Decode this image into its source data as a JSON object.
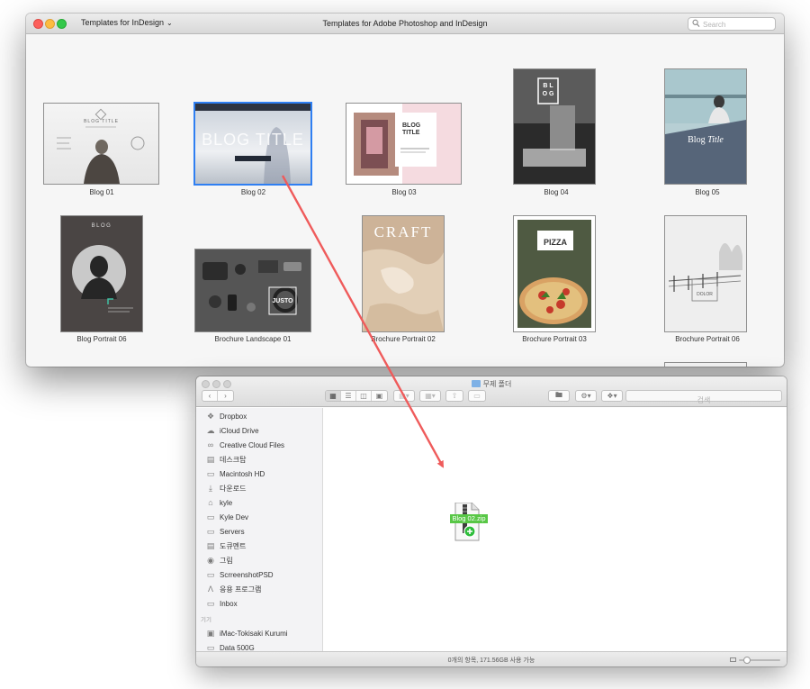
{
  "app": {
    "menu_dropdown": "Templates for InDesign",
    "title": "Templates for Adobe Photoshop and InDesign",
    "search_placeholder": "Search"
  },
  "templates": [
    {
      "label": "Blog 01"
    },
    {
      "label": "Blog 02",
      "selected": true
    },
    {
      "label": "Blog 03"
    },
    {
      "label": "Blog 04"
    },
    {
      "label": "Blog 05"
    },
    {
      "label": "Blog Portrait 06"
    },
    {
      "label": "Brochure Landscape 01"
    },
    {
      "label": "Brochure Portrait 02"
    },
    {
      "label": "Brochure Portrait 03"
    },
    {
      "label": "Brochure Portrait 06"
    }
  ],
  "thumb_text": {
    "blog01": "BLOG TITLE",
    "blog02": "BLOG TITLE",
    "blog03_a": "BLOG",
    "blog03_b": "TITLE",
    "blog04": "B L O G",
    "blog05_a": "Blog",
    "blog05_b": "Title",
    "portrait06": "BLOG",
    "justo": "JUSTO",
    "craft": "CRAFT",
    "pizza": "PIZZA",
    "winter": "DOLOR"
  },
  "finder": {
    "title": "무제 폴더",
    "search_placeholder": "검색",
    "sidebar": [
      {
        "label": "Dropbox",
        "icon": "dropbox-icon"
      },
      {
        "label": "iCloud Drive",
        "icon": "cloud-icon"
      },
      {
        "label": "Creative Cloud Files",
        "icon": "creative-cloud-icon"
      },
      {
        "label": "데스크탑",
        "icon": "desktop-icon"
      },
      {
        "label": "Macintosh HD",
        "icon": "hard-drive-icon"
      },
      {
        "label": "다운로드",
        "icon": "download-icon"
      },
      {
        "label": "kyle",
        "icon": "home-icon"
      },
      {
        "label": "Kyle Dev",
        "icon": "folder-icon"
      },
      {
        "label": "Servers",
        "icon": "folder-icon"
      },
      {
        "label": "도큐멘트",
        "icon": "document-icon"
      },
      {
        "label": "그림",
        "icon": "camera-icon"
      },
      {
        "label": "ScrreenshotPSD",
        "icon": "folder-icon"
      },
      {
        "label": "응용 프로그램",
        "icon": "applications-icon"
      },
      {
        "label": "Inbox",
        "icon": "folder-icon"
      }
    ],
    "devices_header": "기기",
    "devices": [
      {
        "label": "iMac-Tokisaki Kurumi",
        "icon": "imac-icon"
      },
      {
        "label": "Data 500G",
        "icon": "drive-icon"
      }
    ],
    "file_name": "Blog 02.zip",
    "status": "0개의 항목, 171.56GB 사용 가능",
    "zoom_level": 0.2
  },
  "colors": {
    "selection": "#2f7ff2",
    "drag_arrow": "#ef5b5b",
    "file_label": "#58c746"
  }
}
